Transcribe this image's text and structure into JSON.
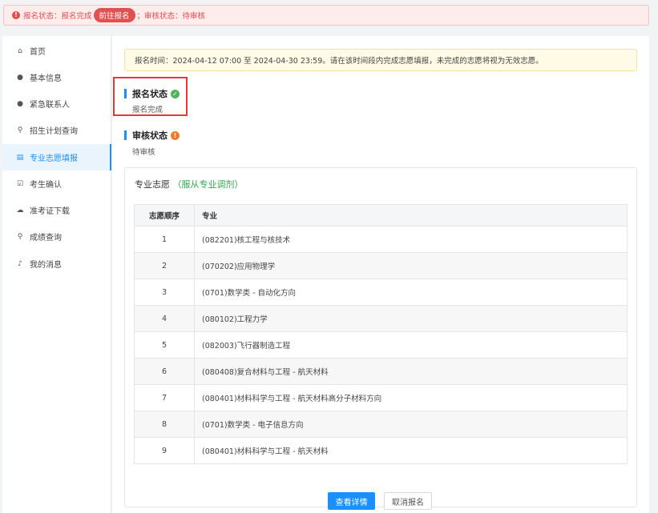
{
  "alert": {
    "icon": "exclamation-icon",
    "text1": "报名状态：报名完成",
    "button": "前往报名",
    "text2": "；审核状态：待审核"
  },
  "sidebar": {
    "items": [
      {
        "icon": "home-icon",
        "glyph": "♠",
        "label": "首页"
      },
      {
        "icon": "user-icon",
        "glyph": "●",
        "label": "基本信息"
      },
      {
        "icon": "user-icon",
        "glyph": "●",
        "label": "紧急联系人"
      },
      {
        "icon": "search-icon",
        "glyph": "⚲",
        "label": "招生计划查询"
      },
      {
        "icon": "document-icon",
        "glyph": "▤",
        "label": "专业志愿填报"
      },
      {
        "icon": "checkbox-icon",
        "glyph": "☑",
        "label": "考生确认"
      },
      {
        "icon": "cloud-download-icon",
        "glyph": "☁",
        "label": "准考证下载"
      },
      {
        "icon": "search-icon",
        "glyph": "⚲",
        "label": "成绩查询"
      },
      {
        "icon": "bell-icon",
        "glyph": "♪",
        "label": "我的消息"
      }
    ],
    "active_index": 4
  },
  "notice": "报名时间：2024-04-12 07:00 至 2024-04-30 23:59。请在该时间段内完成志愿填报，未完成的志愿将视为无效志愿。",
  "registration": {
    "title": "报名状态",
    "status": "报名完成"
  },
  "review": {
    "title": "审核状态",
    "status": "待审核"
  },
  "card": {
    "title": "专业志愿",
    "note": "（服从专业调剂）",
    "headers": [
      "志愿顺序",
      "专业"
    ],
    "rows": [
      [
        "1",
        "(082201)核工程与核技术"
      ],
      [
        "2",
        "(070202)应用物理学"
      ],
      [
        "3",
        "(0701)数学类 - 自动化方向"
      ],
      [
        "4",
        "(080102)工程力学"
      ],
      [
        "5",
        "(082003)飞行器制造工程"
      ],
      [
        "6",
        "(080408)复合材料与工程 - 航天材料"
      ],
      [
        "7",
        "(080401)材料科学与工程 - 航天材料高分子材料方向"
      ],
      [
        "8",
        "(0701)数学类 - 电子信息方向"
      ],
      [
        "9",
        "(080401)材料科学与工程 - 航天材料"
      ]
    ]
  },
  "buttons": {
    "detail": "查看详情",
    "cancel": "取消报名"
  },
  "colors": {
    "accent": "#1a8fff",
    "alert": "#e05252",
    "success": "#52b35a",
    "warning": "#f07b2b"
  }
}
